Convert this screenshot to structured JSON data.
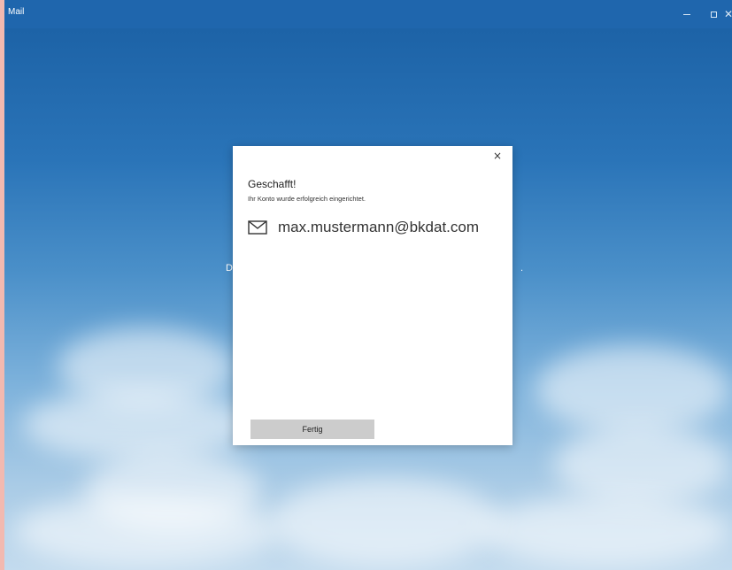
{
  "window": {
    "title": "Mail",
    "controls": {
      "minimize_icon": "minimize-icon",
      "maximize_icon": "maximize-icon",
      "close_icon": "close-icon"
    }
  },
  "background": {
    "text_left": "D",
    "text_right": "."
  },
  "dialog": {
    "heading": "Geschafft!",
    "subtext": "Ihr Konto wurde erfolgreich eingerichtet.",
    "account": {
      "icon": "mail-icon",
      "email": "max.mustermann@bkdat.com"
    },
    "close_glyph": "×",
    "done_label": "Fertig"
  },
  "colors": {
    "titlebar": "#1f66ad",
    "button": "#cccccc"
  }
}
